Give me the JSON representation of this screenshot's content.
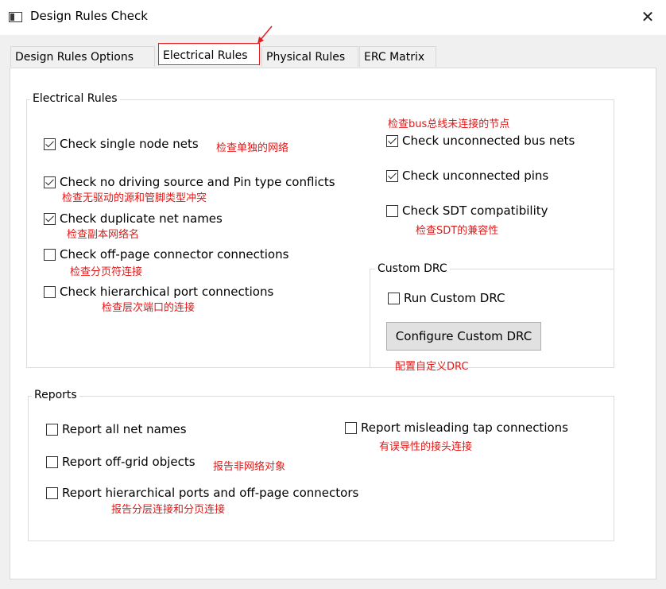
{
  "window": {
    "title": "Design Rules Check",
    "close_glyph": "✕"
  },
  "tabs": [
    {
      "label": "Design Rules Options",
      "active": false
    },
    {
      "label": "Electrical Rules",
      "active": true
    },
    {
      "label": "Physical Rules",
      "active": false
    },
    {
      "label": "ERC Matrix",
      "active": false
    }
  ],
  "electrical_rules": {
    "group_label": "Electrical Rules",
    "left_checks": [
      {
        "label": "Check single node nets",
        "checked": true
      },
      {
        "label": "Check no driving source and Pin type conflicts",
        "checked": true
      },
      {
        "label": "Check duplicate net names",
        "checked": true
      },
      {
        "label": "Check off-page connector connections",
        "checked": false
      },
      {
        "label": "Check hierarchical port connections",
        "checked": false
      }
    ],
    "right_checks": [
      {
        "label": "Check unconnected bus nets",
        "checked": true
      },
      {
        "label": "Check unconnected pins",
        "checked": true
      },
      {
        "label": "Check SDT compatibility",
        "checked": false
      }
    ],
    "custom_drc": {
      "group_label": "Custom DRC",
      "run_label": "Run Custom DRC",
      "run_checked": false,
      "configure_button": "Configure Custom DRC"
    }
  },
  "reports": {
    "group_label": "Reports",
    "checks": [
      {
        "label": "Report all net names",
        "checked": false
      },
      {
        "label": "Report misleading tap connections",
        "checked": false
      },
      {
        "label": "Report off-grid objects",
        "checked": false
      },
      {
        "label": "Report hierarchical ports and off-page connectors",
        "checked": false
      }
    ]
  },
  "annotations": {
    "single_node": "检查单独的网络",
    "no_driving": "检查无驱动的源和管脚类型冲突",
    "duplicate": "检查副本网络名",
    "off_page": "检查分页符连接",
    "hierarchical": "检查层次端口的连接",
    "bus_nets": "检查bus总线未连接的节点",
    "sdt": "检查SDT的兼容性",
    "configure": "配置自定义DRC",
    "misleading": "有误导性的接头连接",
    "off_grid": "报告非网络对象",
    "hier_ports": "报告分层连接和分页连接"
  },
  "colors": {
    "annotation": "#e01818",
    "highlight_box": "#e02020"
  },
  "icons": {
    "window": "window-icon",
    "close": "close-icon",
    "annotation_arrow": "arrow-icon"
  }
}
